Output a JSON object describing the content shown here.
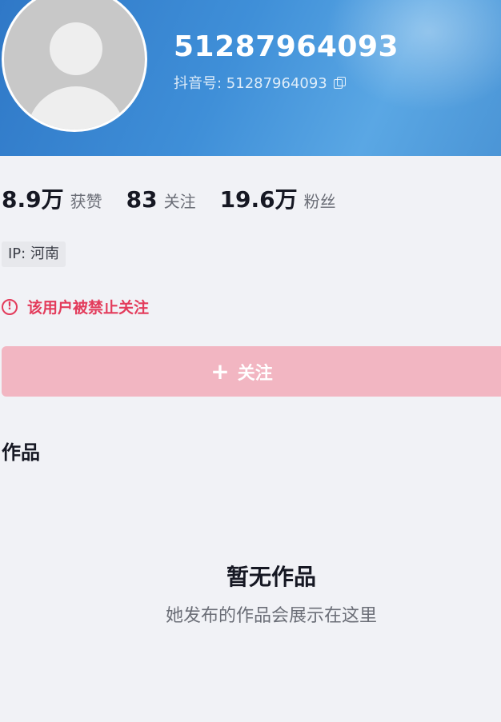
{
  "profile": {
    "nickname": "51287964093",
    "uid_text": "抖音号: 51287964093"
  },
  "stats": [
    {
      "value": "8.9万",
      "label": "获赞"
    },
    {
      "value": "83",
      "label": "关注"
    },
    {
      "value": "19.6万",
      "label": "粉丝"
    }
  ],
  "ip_tag": "IP: 河南",
  "banned_notice": "该用户被禁止关注",
  "follow_button": {
    "icon": "+",
    "label": "关注"
  },
  "works": {
    "title": "作品",
    "empty_title": "暂无作品",
    "empty_subtitle": "她发布的作品会展示在这里"
  },
  "colors": {
    "header_blue": "#3f8fd8",
    "warning_red": "#e33b5b",
    "follow_disabled_pink": "#f2b6c2"
  },
  "icons": [
    "avatar-placeholder-icon",
    "copy-icon",
    "warning-icon",
    "plus-icon"
  ]
}
